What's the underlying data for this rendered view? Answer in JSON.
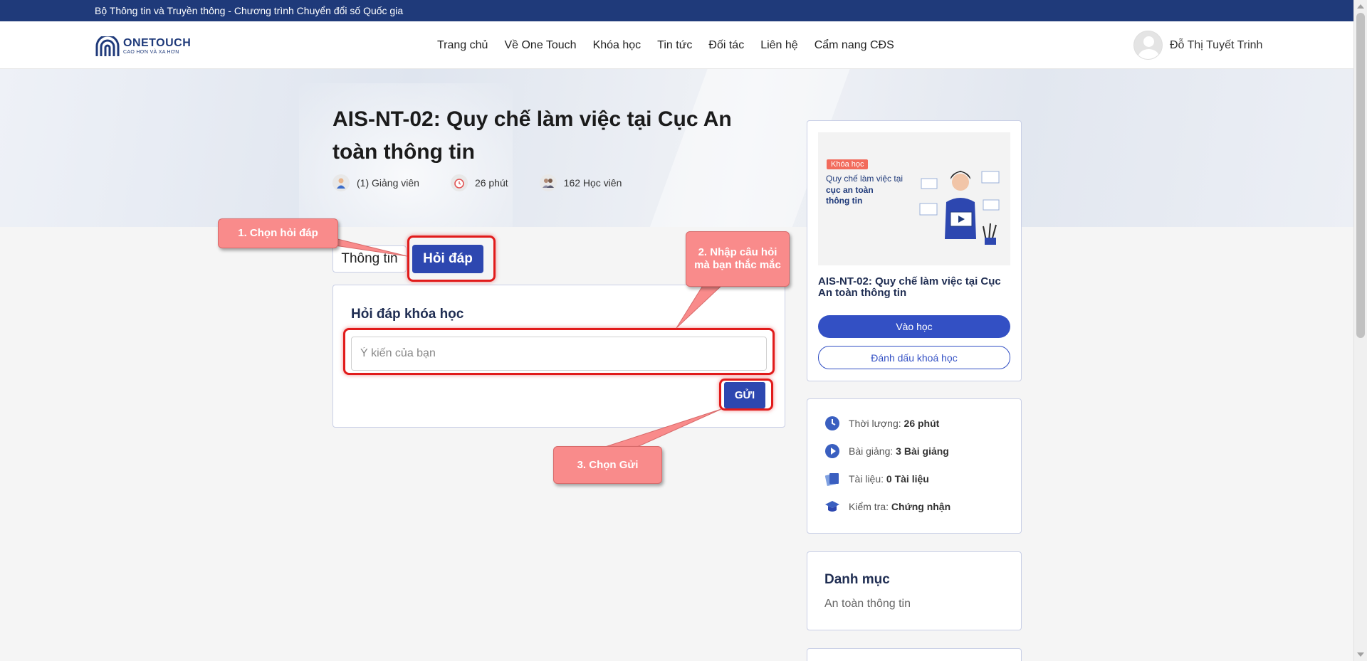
{
  "topbar": {
    "text": "Bộ Thông tin và Truyền thông - Chương trình Chuyển đổi số Quốc gia"
  },
  "logo": {
    "title": "ONETOUCH",
    "subtitle": "CAO HƠN VÀ XA HƠN"
  },
  "nav": {
    "items": [
      "Trang chủ",
      "Về One Touch",
      "Khóa học",
      "Tin tức",
      "Đối tác",
      "Liên hệ",
      "Cẩm nang CĐS"
    ]
  },
  "user": {
    "name": "Đỗ Thị Tuyết Trinh"
  },
  "course": {
    "title": "AIS-NT-02: Quy chế làm việc tại Cục An toàn thông tin",
    "lecturers": "(1) Giảng viên",
    "duration": "26 phút",
    "students": "162 Học viên"
  },
  "tabs": {
    "info": "Thông tin",
    "qa": "Hỏi đáp"
  },
  "qa": {
    "title": "Hỏi đáp khóa học",
    "placeholder": "Ý kiến của bạn",
    "send_label": "GỬI"
  },
  "callouts": {
    "step1": "1. Chọn hỏi đáp",
    "step2": "2. Nhập câu hỏi mà bạn thắc mắc",
    "step3": "3. Chọn Gửi"
  },
  "sidebar": {
    "thumb": {
      "tag": "Khóa học",
      "line1": "Quy chế làm việc tại",
      "line2": "cục an toàn",
      "line3": "thông tin"
    },
    "course_title": "AIS-NT-02: Quy chế làm việc tại Cục An toàn thông tin",
    "enter_label": "Vào học",
    "bookmark_label": "Đánh dấu khoá học",
    "info": {
      "duration_label": "Thời lượng:",
      "duration_value": "26 phút",
      "lessons_label": "Bài giảng:",
      "lessons_value": "3 Bài giảng",
      "docs_label": "Tài liệu:",
      "docs_value": "0 Tài liệu",
      "exam_label": "Kiểm tra:",
      "exam_value": "Chứng nhận"
    },
    "category": {
      "title": "Danh mục",
      "item": "An toàn thông tin"
    }
  },
  "colors": {
    "primary": "#2d47b0",
    "topbar": "#1f3a7a",
    "highlight": "#e11b1b",
    "callout": "#f98b8b"
  }
}
